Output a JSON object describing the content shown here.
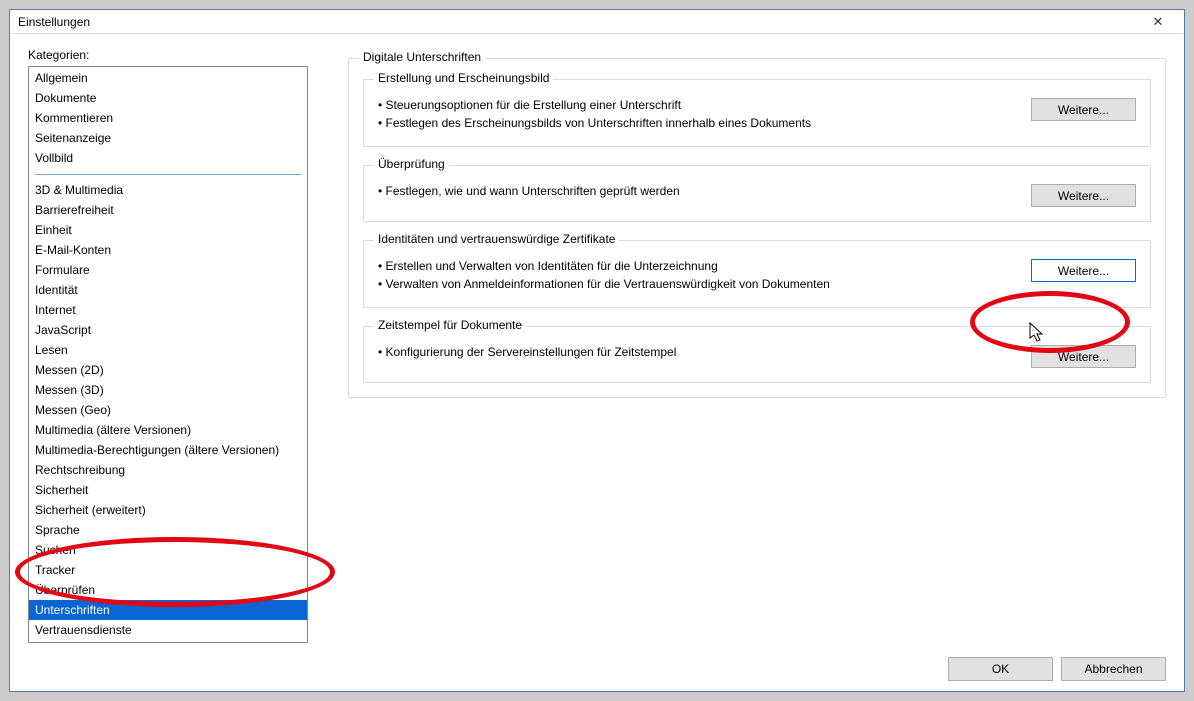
{
  "dialog": {
    "title": "Einstellungen",
    "close": "✕"
  },
  "categories": {
    "label": "Kategorien:",
    "group1": [
      "Allgemein",
      "Dokumente",
      "Kommentieren",
      "Seitenanzeige",
      "Vollbild"
    ],
    "group2": [
      "3D & Multimedia",
      "Barrierefreiheit",
      "Einheit",
      "E-Mail-Konten",
      "Formulare",
      "Identität",
      "Internet",
      "JavaScript",
      "Lesen",
      "Messen (2D)",
      "Messen (3D)",
      "Messen (Geo)",
      "Multimedia (ältere Versionen)",
      "Multimedia-Berechtigungen (ältere Versionen)",
      "Rechtschreibung",
      "Sicherheit",
      "Sicherheit (erweitert)",
      "Sprache",
      "Suchen",
      "Tracker",
      "Überprüfen",
      "Unterschriften",
      "Vertrauensdienste"
    ],
    "selected": "Unterschriften"
  },
  "panel": {
    "title": "Digitale Unterschriften",
    "sections": [
      {
        "title": "Erstellung und Erscheinungsbild",
        "bullets": [
          "• Steuerungsoptionen für die Erstellung einer Unterschrift",
          "• Festlegen des Erscheinungsbilds von Unterschriften innerhalb eines Dokuments"
        ],
        "button": "Weitere..."
      },
      {
        "title": "Überprüfung",
        "bullets": [
          "• Festlegen, wie und wann Unterschriften geprüft werden"
        ],
        "button": "Weitere..."
      },
      {
        "title": "Identitäten und vertrauenswürdige Zertifikate",
        "bullets": [
          "• Erstellen und Verwalten von Identitäten für die Unterzeichnung",
          "• Verwalten von Anmeldeinformationen für die Vertrauenswürdigkeit von Dokumenten"
        ],
        "button": "Weitere...",
        "highlight": true
      },
      {
        "title": "Zeitstempel für Dokumente",
        "bullets": [
          "• Konfigurierung der Servereinstellungen für Zeitstempel"
        ],
        "button": "Weitere..."
      }
    ]
  },
  "footer": {
    "ok": "OK",
    "cancel": "Abbrechen"
  }
}
